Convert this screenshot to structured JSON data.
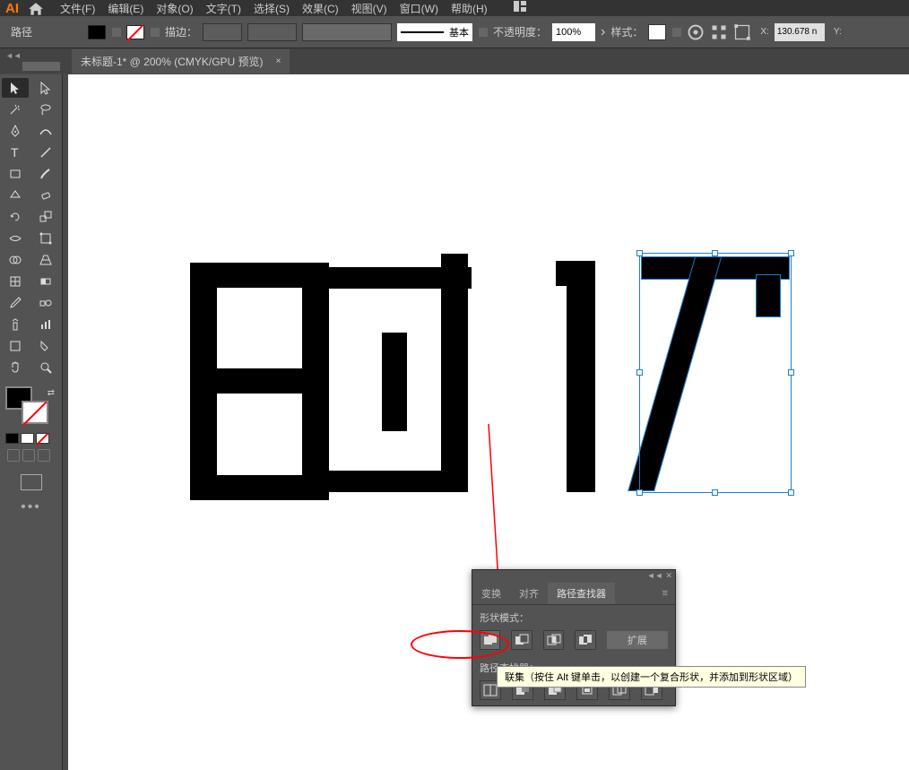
{
  "app": {
    "logo": "AI"
  },
  "menu": {
    "file": "文件(F)",
    "edit": "编辑(E)",
    "object": "对象(O)",
    "type": "文字(T)",
    "select": "选择(S)",
    "effect": "效果(C)",
    "view": "视图(V)",
    "window": "窗口(W)",
    "help": "帮助(H)"
  },
  "options": {
    "selection_label": "路径",
    "stroke_label": "描边：",
    "brush_basic": "基本",
    "opacity_label": "不透明度：",
    "opacity_value": "100%",
    "style_label": "样式：",
    "x_label": "X:",
    "x_value": "130.678  n",
    "y_label": "Y:"
  },
  "tab": {
    "title": "未标题-1* @ 200% (CMYK/GPU 预览)",
    "close": "×"
  },
  "tools": {
    "icons": [
      "selection",
      "direct-selection",
      "magic-wand",
      "lasso",
      "pen",
      "curvature",
      "type",
      "line",
      "rectangle",
      "paintbrush",
      "shaper",
      "eraser",
      "rotate",
      "scale",
      "width",
      "free-transform",
      "shape-builder",
      "perspective",
      "mesh",
      "gradient",
      "eyedropper",
      "blend",
      "symbol-sprayer",
      "graph",
      "artboard",
      "slice",
      "hand",
      "zoom"
    ]
  },
  "pathfinder": {
    "tabs": {
      "transform": "变换",
      "align": "对齐",
      "pathfinder": "路径查找器"
    },
    "shape_modes_label": "形状模式：",
    "expand_label": "扩展",
    "pathfinders_label": "路径查找器："
  },
  "tooltip": {
    "text": "联集（按住 Alt 键单击，以创建一个复合形状，并添加到形状区域）"
  },
  "colors": {
    "accent": "#1a7fd4",
    "annotation": "#ff0000"
  }
}
